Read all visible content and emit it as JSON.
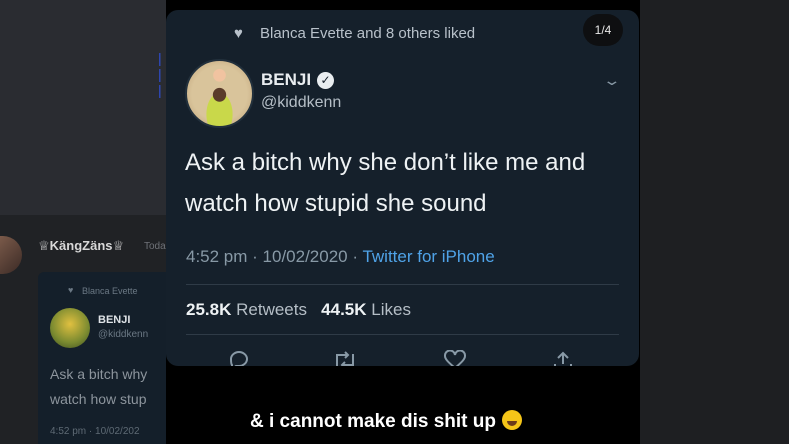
{
  "background": {
    "username": "♕KängZäns♕",
    "time_fragment": "Toda",
    "embed": {
      "liked_fragment": "Blanca Evette",
      "name": "BENJI",
      "handle": "@kiddkenn",
      "text_line1": "Ask a bitch why",
      "text_line2": "watch how stup",
      "timestamp": "4:52 pm · 10/02/202"
    }
  },
  "tweet": {
    "liked_by": "Blanca Evette and 8 others liked",
    "page_indicator": "1/4",
    "display_name": "BENJI",
    "handle": "@kiddkenn",
    "text": "Ask a bitch why she don’t like me and watch how stupid she sound",
    "time": "4:52 pm · 10/02/2020 ·",
    "source": "Twitter for iPhone",
    "retweets_count": "25.8K",
    "retweets_label": "Retweets",
    "likes_count": "44.5K",
    "likes_label": "Likes"
  },
  "caption": "& i cannot make dis shit up",
  "icons": {
    "heart": "heart-icon",
    "verified": "verified-icon",
    "chevron": "chevron-down-icon",
    "reply": "reply-icon",
    "retweet": "retweet-icon",
    "like": "like-icon",
    "share": "share-icon",
    "emoji": "laughing-emoji-icon"
  },
  "colors": {
    "card_bg": "#15202b",
    "link_blue": "#4fa3e8"
  }
}
